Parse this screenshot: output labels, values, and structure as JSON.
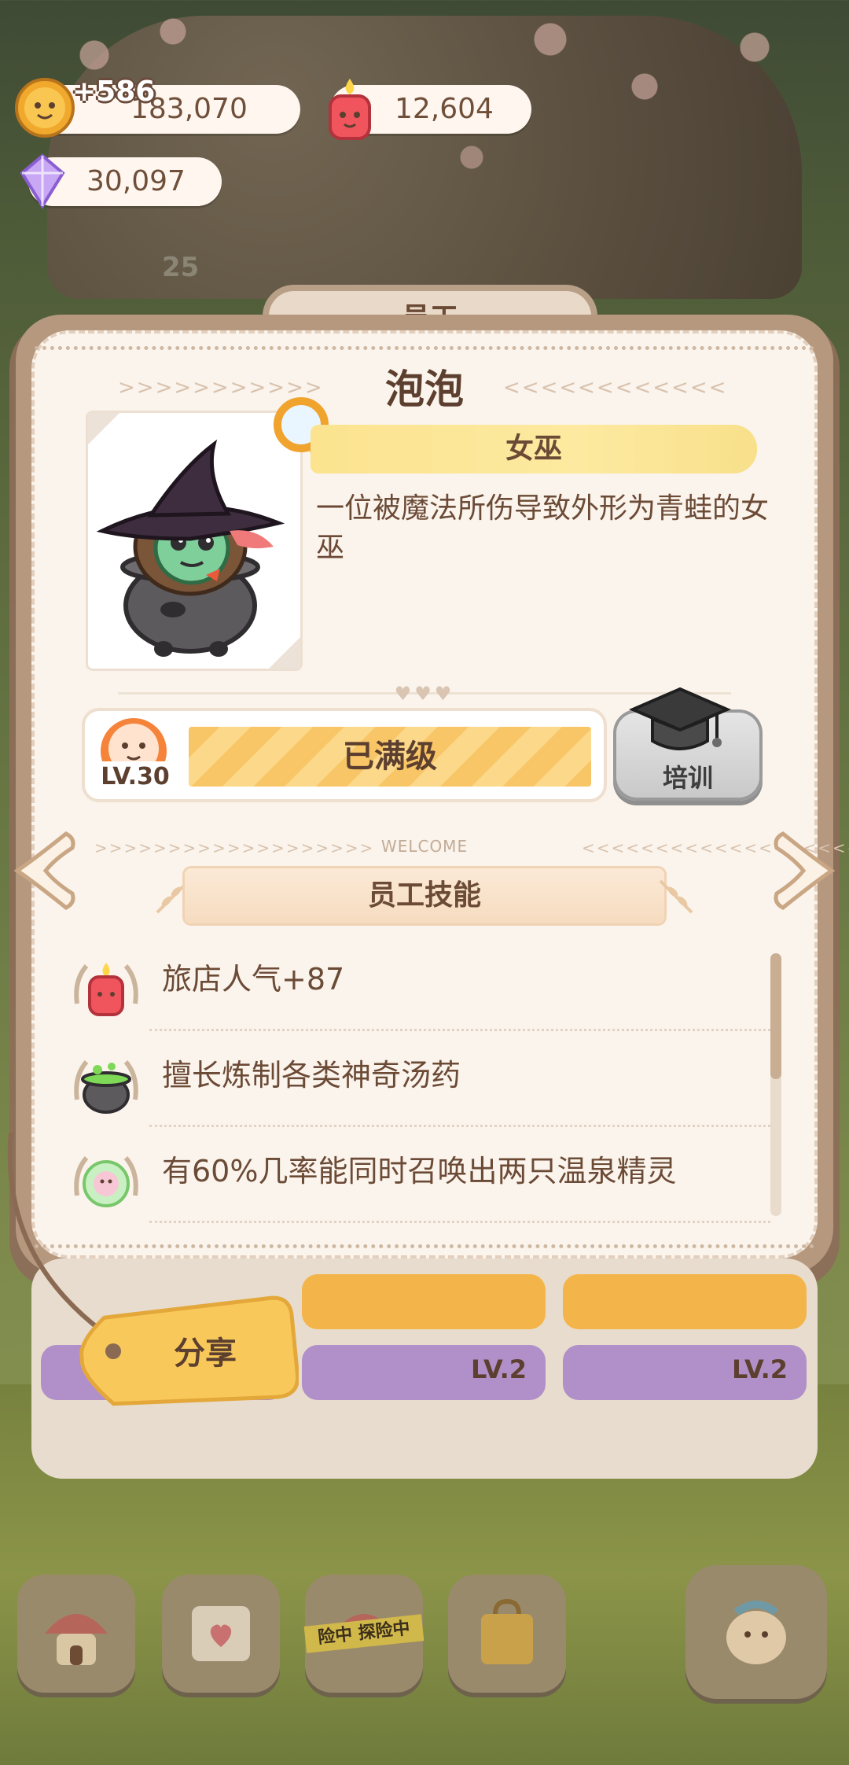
{
  "resources": {
    "coins": "183,070",
    "coins_gain": "+586",
    "popularity": "12,604",
    "gems": "30,097",
    "bg_counter": "25"
  },
  "staff_tab": "员工",
  "character": {
    "name": "泡泡",
    "role": "女巫",
    "description": "一位被魔法所伤导致外形为青蛙的女巫",
    "level_label": "LV.30",
    "level_status": "已满级"
  },
  "train_button": "培训",
  "welcome": "WELCOME",
  "skills_title": "员工技能",
  "skills": [
    {
      "icon": "candle-icon",
      "text": "旅店人气+87"
    },
    {
      "icon": "cauldron-icon",
      "text": "擅长炼制各类神奇汤药"
    },
    {
      "icon": "spirit-icon",
      "text": "有60%几率能同时召唤出两只温泉精灵"
    }
  ],
  "share_button": "分享",
  "under_panel": {
    "card1_level": "LV.2",
    "card2_level": "LV.2"
  },
  "bottom_nav": {
    "explore_tape": "险中 探险中"
  },
  "colors": {
    "accent_yellow": "#fbe38f",
    "text_brown": "#6b4a36",
    "page_bg": "#fbf4ec"
  }
}
